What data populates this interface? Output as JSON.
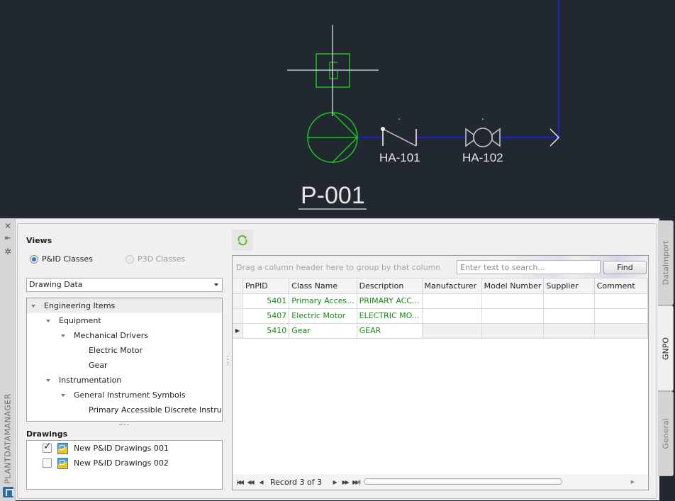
{
  "drawing": {
    "equipment_tag": "P-001",
    "valve_tags": [
      "HA-101",
      "HA-102"
    ],
    "colors": {
      "background": "#212830",
      "equipment": "#19c819",
      "pipe": "#1f1fd2",
      "annotation": "#e6e6e6"
    }
  },
  "palette": {
    "title": "PLANTDATAMANAGER",
    "strip_icons": [
      "close-icon",
      "auto-hide-icon",
      "properties-icon"
    ],
    "views": {
      "title": "Views",
      "radio_options": [
        {
          "label": "P&ID Classes",
          "checked": true,
          "enabled": true
        },
        {
          "label": "P3D Classes",
          "checked": false,
          "enabled": false
        }
      ],
      "selected_view": "Drawing Data",
      "tree": [
        {
          "label": "Engineering Items",
          "level": 0,
          "expanded": true,
          "selected": true
        },
        {
          "label": "Equipment",
          "level": 1,
          "expanded": true
        },
        {
          "label": "Mechanical Drivers",
          "level": 2,
          "expanded": true
        },
        {
          "label": "Electric Motor",
          "level": 3
        },
        {
          "label": "Gear",
          "level": 3
        },
        {
          "label": "Instrumentation",
          "level": 1,
          "expanded": true
        },
        {
          "label": "General Instrument Symbols",
          "level": 2,
          "expanded": true
        },
        {
          "label": "Primary Accessible Discrete Instrument",
          "level": 3
        }
      ]
    },
    "drawings": {
      "title": "Drawings",
      "items": [
        {
          "label": "New P&ID Drawings 001",
          "checked": true
        },
        {
          "label": "New P&ID Drawings 002",
          "checked": false
        }
      ]
    },
    "grid": {
      "group_hint": "Drag a column header here to group by that column",
      "search_placeholder": "Enter text to search...",
      "find_label": "Find",
      "columns": [
        "PnPID",
        "Class Name",
        "Description",
        "Manufacturer",
        "Model Number",
        "Supplier",
        "Comment"
      ],
      "rows": [
        {
          "PnPID": "5401",
          "Class Name": "Primary Acces...",
          "Description": "PRIMARY ACC...",
          "Manufacturer": "",
          "Model Number": "",
          "Supplier": "",
          "Comment": ""
        },
        {
          "PnPID": "5407",
          "Class Name": "Electric Motor",
          "Description": "ELECTRIC MO...",
          "Manufacturer": "",
          "Model Number": "",
          "Supplier": "",
          "Comment": ""
        },
        {
          "PnPID": "5410",
          "Class Name": "Gear",
          "Description": "GEAR",
          "Manufacturer": "",
          "Model Number": "",
          "Supplier": "",
          "Comment": ""
        }
      ],
      "focused_row": 2,
      "record_text": "Record 3 of 3",
      "value_color": "#178a17"
    },
    "side_tabs": [
      {
        "label": "DataImport",
        "active": false
      },
      {
        "label": "GNPO",
        "active": true
      },
      {
        "label": "General",
        "active": false
      }
    ]
  }
}
